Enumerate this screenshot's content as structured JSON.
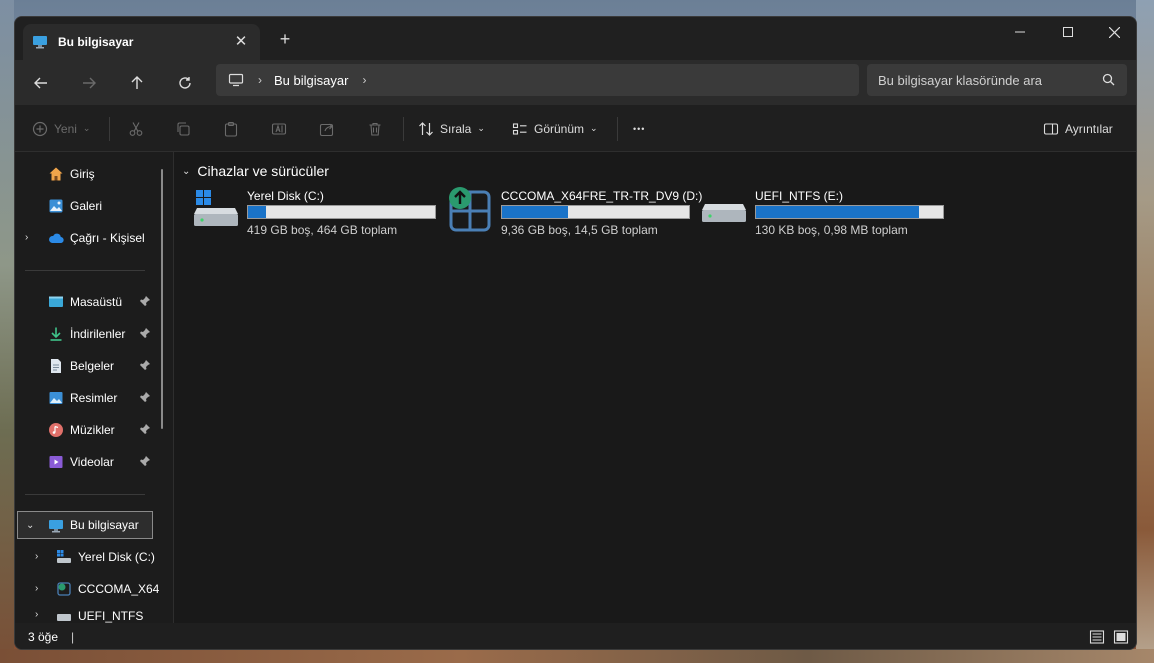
{
  "tab": {
    "title": "Bu bilgisayar",
    "close": "✕",
    "new_tab": "+"
  },
  "window_controls": {
    "minimize": "—",
    "maximize": "☐",
    "close": "✕"
  },
  "address": {
    "crumb": "Bu bilgisayar",
    "sep": "›"
  },
  "search": {
    "placeholder": "Bu bilgisayar klasöründe ara"
  },
  "toolbar": {
    "new_label": "Yeni",
    "sort_label": "Sırala",
    "view_label": "Görünüm",
    "more": "•••",
    "details_label": "Ayrıntılar"
  },
  "sidebar": {
    "home": "Giriş",
    "gallery": "Galeri",
    "onedrive": "Çağrı - Kişisel",
    "desktop": "Masaüstü",
    "downloads": "İndirilenler",
    "documents": "Belgeler",
    "pictures": "Resimler",
    "music": "Müzikler",
    "videos": "Videolar",
    "this_pc": "Bu bilgisayar",
    "drive_c": "Yerel Disk (C:)",
    "drive_d": "CCCOMA_X64",
    "drive_e": "UEFI_NTFS (E:)"
  },
  "content": {
    "group_title": "Cihazlar ve sürücüler",
    "drives": [
      {
        "name": "Yerel Disk (C:)",
        "info": "419 GB boş, 464 GB toplam",
        "used_fraction": 0.097
      },
      {
        "name": "CCCOMA_X64FRE_TR-TR_DV9 (D:)",
        "info": "9,36 GB boş, 14,5 GB toplam",
        "used_fraction": 0.355
      },
      {
        "name": "UEFI_NTFS (E:)",
        "info": "130 KB boş, 0,98 MB toplam",
        "used_fraction": 0.87
      }
    ]
  },
  "status": {
    "count": "3 öğe",
    "caret": "|"
  },
  "colors": {
    "accent": "#1a73c8",
    "window_bg": "#191919",
    "bar_bg": "#e6e6e6"
  }
}
